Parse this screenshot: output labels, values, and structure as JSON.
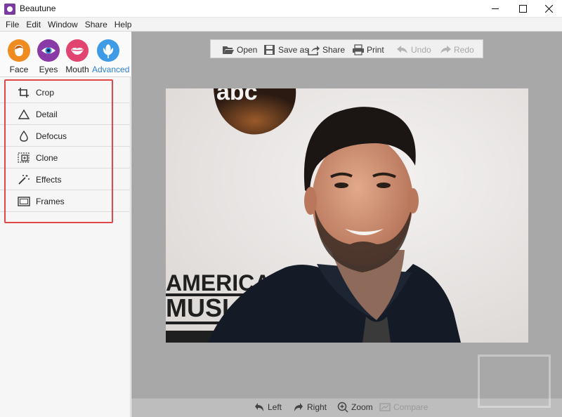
{
  "window": {
    "title": "Beautune"
  },
  "menu": [
    "File",
    "Edit",
    "Window",
    "Share",
    "Help"
  ],
  "modes": [
    {
      "label": "Face",
      "icon": "face-icon",
      "color": "#f08b1f",
      "active": false
    },
    {
      "label": "Eyes",
      "icon": "eye-icon",
      "color": "#8a3aa6",
      "active": false
    },
    {
      "label": "Mouth",
      "icon": "lips-icon",
      "color": "#e0446f",
      "active": false
    },
    {
      "label": "Advanced",
      "icon": "flower-icon",
      "color": "#3f9be6",
      "active": true
    }
  ],
  "tools": [
    {
      "label": "Crop",
      "icon": "crop-icon"
    },
    {
      "label": "Detail",
      "icon": "triangle-icon"
    },
    {
      "label": "Defocus",
      "icon": "drop-icon"
    },
    {
      "label": "Clone",
      "icon": "clone-icon"
    },
    {
      "label": "Effects",
      "icon": "magic-wand-icon"
    },
    {
      "label": "Frames",
      "icon": "frame-icon"
    }
  ],
  "toolbar": {
    "open": "Open",
    "save_as": "Save as",
    "share": "Share",
    "print": "Print",
    "undo": "Undo",
    "redo": "Redo"
  },
  "bottom": {
    "left": "Left",
    "right": "Right",
    "zoom": "Zoom",
    "compare": "Compare"
  },
  "photo": {
    "sign_top": "abc",
    "sign_line1": "AMERICA",
    "sign_line2": "MUSI"
  },
  "colors": {
    "accent": "#2d7fd3",
    "highlight": "#e04848"
  }
}
